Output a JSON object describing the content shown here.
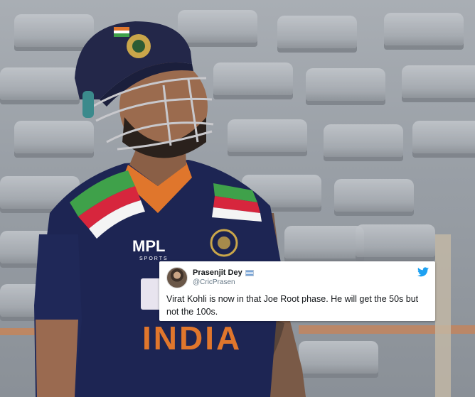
{
  "image": {
    "subject": "cricketer-in-helmet",
    "colors": {
      "jersey": "#1d2553",
      "helmet": "#232749",
      "stands": "#a6abb1",
      "accent_orange": "#e0762c"
    }
  },
  "tweet": {
    "display_name": "Prasenjit Dey",
    "handle": "@CricPrasen",
    "text": "Virat Kohli is now in that Joe Root phase. He will get the 50s but not the 100s.",
    "icons": [
      "verified-flag-icon",
      "twitter-bird-icon"
    ],
    "brand_color": "#1da1f2"
  },
  "jersey_marks": {
    "sponsor": "MPL",
    "sponsor_sub": "SPORTS",
    "chest_text": "INDIA"
  }
}
